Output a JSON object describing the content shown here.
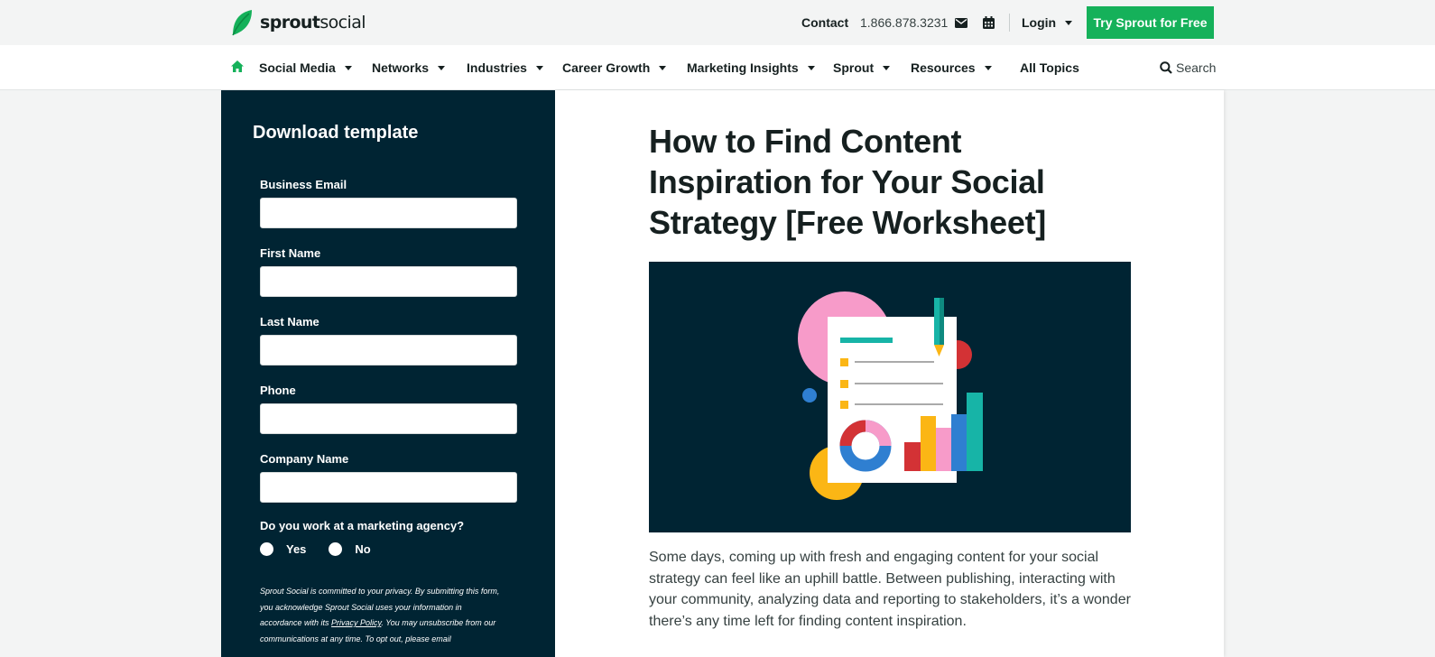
{
  "header": {
    "brand_bold": "sprout",
    "brand_rest": "social",
    "contact_label": "Contact",
    "phone": "1.866.878.3231",
    "login_label": "Login",
    "cta_label": "Try Sprout for Free",
    "icons": {
      "logo": "leaf-logo",
      "mail": "envelope-icon",
      "calendar": "calendar-icon",
      "caret": "caret-down-icon"
    }
  },
  "nav": {
    "home_icon": "home-icon",
    "items": [
      {
        "label": "Social Media"
      },
      {
        "label": "Networks"
      },
      {
        "label": "Industries"
      },
      {
        "label": "Career Growth"
      },
      {
        "label": "Marketing Insights"
      },
      {
        "label": "Sprout"
      },
      {
        "label": "Resources"
      },
      {
        "label": "All Topics"
      }
    ],
    "search_label": "Search"
  },
  "form": {
    "title": "Download template",
    "fields": [
      {
        "label": "Business Email",
        "value": ""
      },
      {
        "label": "First Name",
        "value": ""
      },
      {
        "label": "Last Name",
        "value": ""
      },
      {
        "label": "Phone",
        "value": ""
      },
      {
        "label": "Company Name",
        "value": ""
      }
    ],
    "agency_question": "Do you work at a marketing agency?",
    "option_yes": "Yes",
    "option_no": "No",
    "privacy_line1": "Sprout Social is committed to your privacy. By submitting this form,",
    "privacy_line2": "you acknowledge Sprout Social uses your information in",
    "privacy_line3a": "accordance with its ",
    "privacy_link": "Privacy Policy",
    "privacy_line3b": ". You may unsubscribe from our",
    "privacy_line4": "communications at any time. To opt out, please email"
  },
  "article": {
    "title": "How to Find Content Inspiration for Your Social Strategy [Free Worksheet]",
    "body": "Some days, coming up with fresh and engaging content for your social strategy can feel like an uphill battle. Between publishing, interacting with your community, analyzing data and reporting to stakeholders, it’s a wonder there’s any time left for finding content inspiration."
  },
  "colors": {
    "brand_green": "#15b15a",
    "navy": "#002433",
    "illustration_pink": "#f79bc9",
    "illustration_red": "#d33235",
    "illustration_blue": "#2f7fd1",
    "illustration_yellow": "#fbb615",
    "illustration_teal": "#17b4a7"
  }
}
